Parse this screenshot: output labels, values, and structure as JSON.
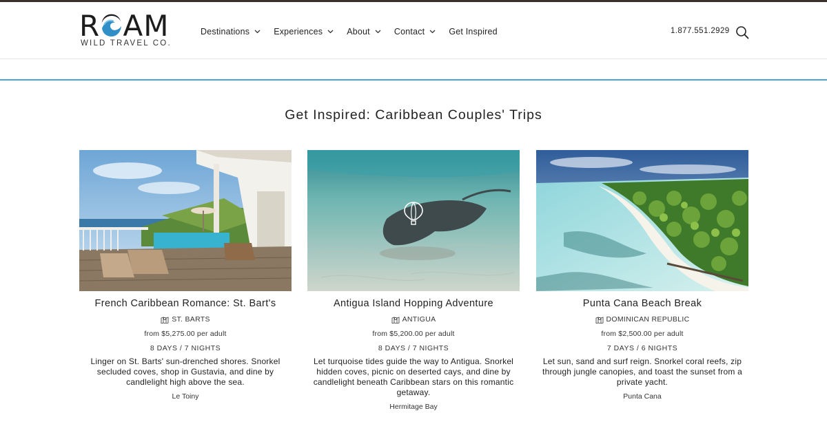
{
  "brand": {
    "name": "ROAM",
    "tagline": "WILD TRAVEL CO."
  },
  "nav": {
    "items": [
      {
        "label": "Destinations",
        "has_dropdown": true
      },
      {
        "label": "Experiences",
        "has_dropdown": true
      },
      {
        "label": "About",
        "has_dropdown": true
      },
      {
        "label": "Contact",
        "has_dropdown": true
      },
      {
        "label": "Get Inspired",
        "has_dropdown": false
      }
    ],
    "phone": "1.877.551.2929"
  },
  "page": {
    "title": "Get Inspired: Caribbean Couples' Trips"
  },
  "cards": [
    {
      "title": "French Caribbean Romance: St. Bart's",
      "location": "ST. BARTS",
      "price": "from $5,275.00 per adult",
      "duration": "8 DAYS / 7 NIGHTS",
      "description": "Linger on St. Barts' sun-drenched shores. Snorkel secluded coves, shop in Gustavia, and dine by candlelight high above the sea.",
      "hotel": "Le Toiny"
    },
    {
      "title": "Antigua Island Hopping Adventure",
      "location": "ANTIGUA",
      "price": "from $5,200.00 per adult",
      "duration": "8 DAYS / 7 NIGHTS",
      "description": "Let turquoise tides guide the way to Antigua. Snorkel hidden coves, picnic on deserted cays, and dine by candlelight beneath Caribbean stars on this romantic getaway.",
      "hotel": "Hermitage Bay"
    },
    {
      "title": "Punta Cana Beach Break",
      "location": "DOMINICAN REPUBLIC",
      "price": "from $2,500.00 per adult",
      "duration": "7 DAYS / 6 NIGHTS",
      "description": "Let sun, sand and surf reign. Snorkel coral reefs, zip through jungle canopies, and toast the sunset from a private yacht.",
      "hotel": "Punta Cana"
    }
  ],
  "colors": {
    "accent_rule": "#4aa7d3",
    "top_strip": "#3a302c",
    "logo_wave": "#2f8fc6"
  },
  "icons": [
    "roam-wave-logo-icon",
    "chevron-down-icon",
    "search-icon",
    "map-icon",
    "hot-air-balloon-icon"
  ]
}
